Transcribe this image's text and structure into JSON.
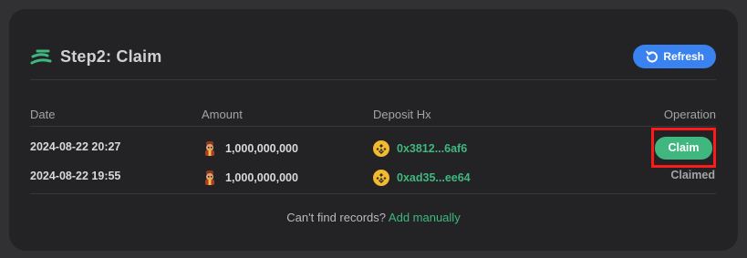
{
  "header": {
    "title": "Step2: Claim",
    "refresh_label": "Refresh"
  },
  "table": {
    "columns": [
      "Date",
      "Amount",
      "Deposit Hx",
      "Operation"
    ],
    "rows": [
      {
        "date": "2024-08-22 20:27",
        "amount": "1,000,000,000",
        "hash": "0x3812...6af6",
        "operation": "Claim"
      },
      {
        "date": "2024-08-22 19:55",
        "amount": "1,000,000,000",
        "hash": "0xad35...ee64",
        "operation": "Claimed"
      }
    ]
  },
  "footer": {
    "text": "Can't find records?",
    "link": "Add manually"
  },
  "colors": {
    "accent_green": "#3fb77f",
    "refresh_blue": "#3a82f0",
    "highlight_red": "#ff1a1a"
  }
}
